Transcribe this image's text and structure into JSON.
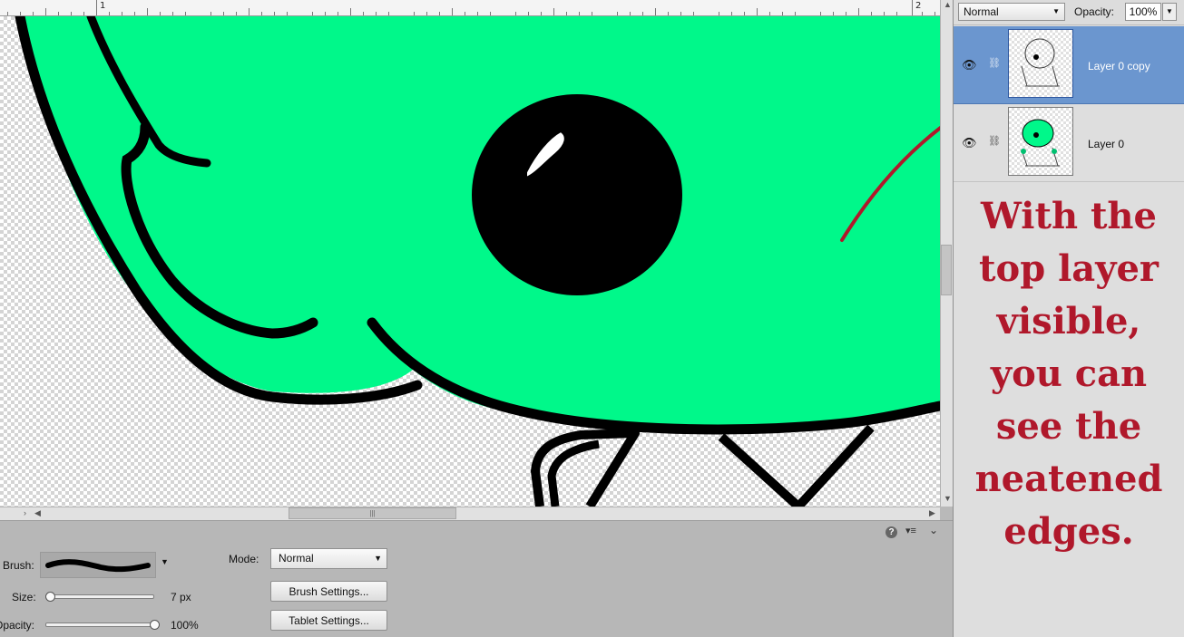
{
  "ruler": {
    "marks": [
      "1",
      "2"
    ]
  },
  "options": {
    "brush_label": "Brush:",
    "size_label": "Size:",
    "size_value": "7 px",
    "opacity_label": "Opacity:",
    "opacity_value": "100%",
    "mode_label": "Mode:",
    "mode_value": "Normal",
    "brush_settings": "Brush Settings...",
    "tablet_settings": "Tablet Settings...",
    "size_fraction": 0.0,
    "opacity_fraction": 1.0
  },
  "layers_panel": {
    "blend_mode": "Normal",
    "opacity_label": "Opacity:",
    "opacity_value": "100%",
    "layers": [
      {
        "name": "Layer 0 copy",
        "selected": true,
        "visible": true
      },
      {
        "name": "Layer 0",
        "selected": false,
        "visible": true
      }
    ]
  },
  "annotation": {
    "text": "With the top layer visible, you can see the neatened edges."
  },
  "colors": {
    "fill_green": "#00f88a",
    "selected_layer": "#6b96cf",
    "annotation_red": "#b0182b"
  }
}
